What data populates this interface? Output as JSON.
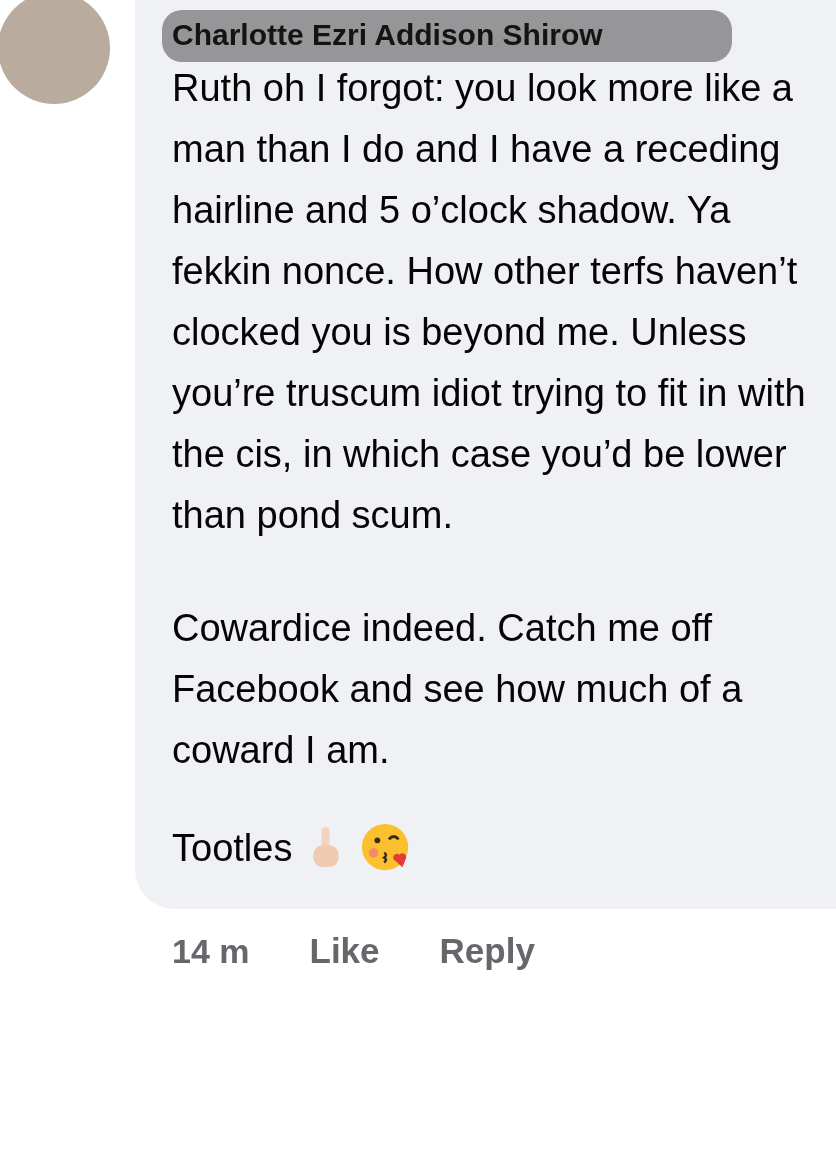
{
  "comment": {
    "author": "Charlotte Ezri Addison Shirow",
    "mention": "Ruth",
    "paragraphs": [
      "oh I forgot: you look more like a man than I do and I have a receding hairline and 5 o’clock shadow. Ya fekkin nonce. How other terfs haven’t clocked you is beyond me. Unless you’re truscum idiot trying to fit in with the cis, in which case you’d be lower than pond scum.",
      "Cowardice indeed. Catch me off Facebook and see how much of a coward I am."
    ],
    "sign_off": "Tootles"
  },
  "actions": {
    "time": "14 m",
    "buttons": [
      "Like",
      "Reply"
    ]
  }
}
